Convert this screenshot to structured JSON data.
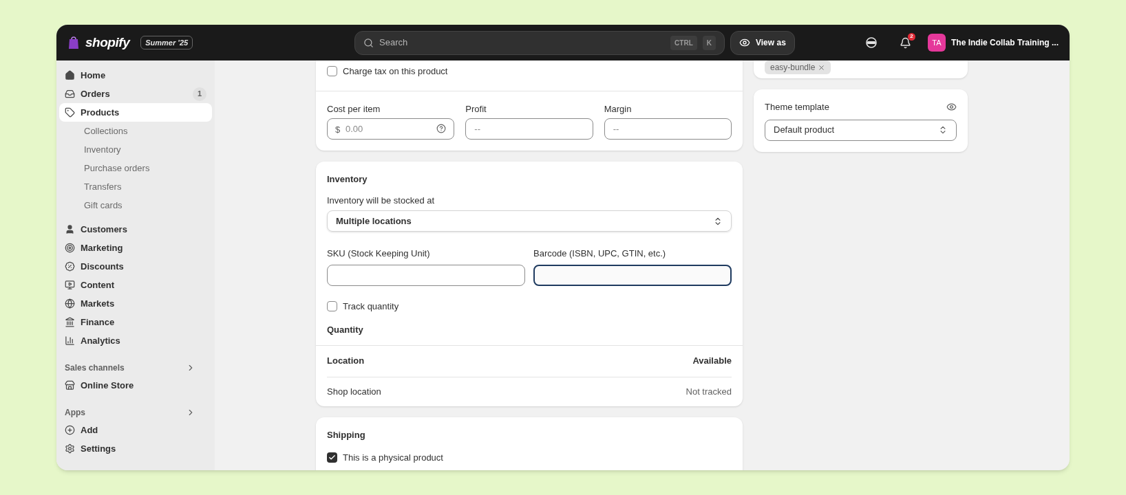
{
  "topbar": {
    "logo": "shopify",
    "edition": "Summer '25",
    "search": {
      "placeholder": "Search",
      "shortcut": [
        "CTRL",
        "K"
      ]
    },
    "view_as": "View as",
    "notifications": {
      "count": "2"
    },
    "store": {
      "initials": "TA",
      "name": "The Indie Collab Training ..."
    }
  },
  "sidebar": {
    "items": [
      {
        "label": "Home",
        "selected": false
      },
      {
        "label": "Orders",
        "selected": false,
        "badge": "1"
      },
      {
        "label": "Products",
        "selected": true,
        "children": [
          {
            "label": "Collections",
            "selected": false
          },
          {
            "label": "Inventory",
            "selected": false
          },
          {
            "label": "Purchase orders",
            "selected": false
          },
          {
            "label": "Transfers",
            "selected": false
          },
          {
            "label": "Gift cards",
            "selected": false
          }
        ]
      },
      {
        "label": "Customers",
        "selected": false
      },
      {
        "label": "Marketing",
        "selected": false
      },
      {
        "label": "Discounts",
        "selected": false
      },
      {
        "label": "Content",
        "selected": false
      },
      {
        "label": "Markets",
        "selected": false
      },
      {
        "label": "Finance",
        "selected": false
      },
      {
        "label": "Analytics",
        "selected": false
      }
    ],
    "sections": [
      {
        "title": "Sales channels",
        "items": [
          {
            "label": "Online Store",
            "selected": false
          }
        ]
      },
      {
        "title": "Apps",
        "items": [
          {
            "label": "Add",
            "selected": false
          },
          {
            "label": "Settings",
            "selected": false
          }
        ]
      }
    ]
  },
  "pricing": {
    "charge_tax": {
      "label": "Charge tax on this product",
      "checked": false
    },
    "cost": {
      "label": "Cost per item",
      "prefix": "$",
      "placeholder": "0.00"
    },
    "profit": {
      "label": "Profit",
      "placeholder": "--"
    },
    "margin": {
      "label": "Margin",
      "placeholder": "--"
    }
  },
  "inventory": {
    "title": "Inventory",
    "stocked_label": "Inventory will be stocked at",
    "stocked_value": "Multiple locations",
    "sku": {
      "label": "SKU (Stock Keeping Unit)",
      "focused": false
    },
    "barcode": {
      "label": "Barcode (ISBN, UPC, GTIN, etc.)",
      "focused": true
    },
    "track_quantity": {
      "label": "Track quantity",
      "checked": false
    },
    "quantity_title": "Quantity",
    "table": {
      "columns": [
        "Location",
        "Available"
      ],
      "rows": [
        [
          "Shop location",
          "Not tracked"
        ]
      ]
    }
  },
  "shipping": {
    "title": "Shipping",
    "physical": {
      "label": "This is a physical product",
      "checked": true
    }
  },
  "right": {
    "tags": [
      {
        "label": "easy-bundle"
      }
    ],
    "theme_template": {
      "label": "Theme template",
      "value": "Default product"
    }
  }
}
